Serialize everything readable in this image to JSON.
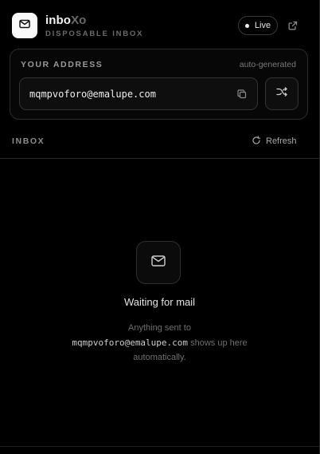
{
  "header": {
    "brand_main": "inbo",
    "brand_accent": "Xo",
    "subtitle": "DISPOSABLE INBOX",
    "live_label": "Live",
    "icons": {
      "logo": "mail-icon",
      "external": "external-link-icon"
    }
  },
  "address_card": {
    "label": "YOUR ADDRESS",
    "note": "auto-generated",
    "email": "mqmpvoforo@emalupe.com",
    "icons": {
      "copy": "copy-icon",
      "shuffle": "shuffle-icon"
    }
  },
  "inbox": {
    "title": "INBOX",
    "refresh_label": "Refresh",
    "icons": {
      "refresh": "refresh-icon"
    }
  },
  "empty_state": {
    "title": "Waiting for mail",
    "line_before": "Anything sent to",
    "email": "mqmpvoforo@emalupe.com",
    "line_after": "shows up here",
    "line_last": "automatically.",
    "icons": {
      "mail": "mail-icon"
    }
  },
  "colors": {
    "background": "#000000",
    "logo_bg": "#fafafa",
    "accent_muted": "#6a6a6a"
  }
}
